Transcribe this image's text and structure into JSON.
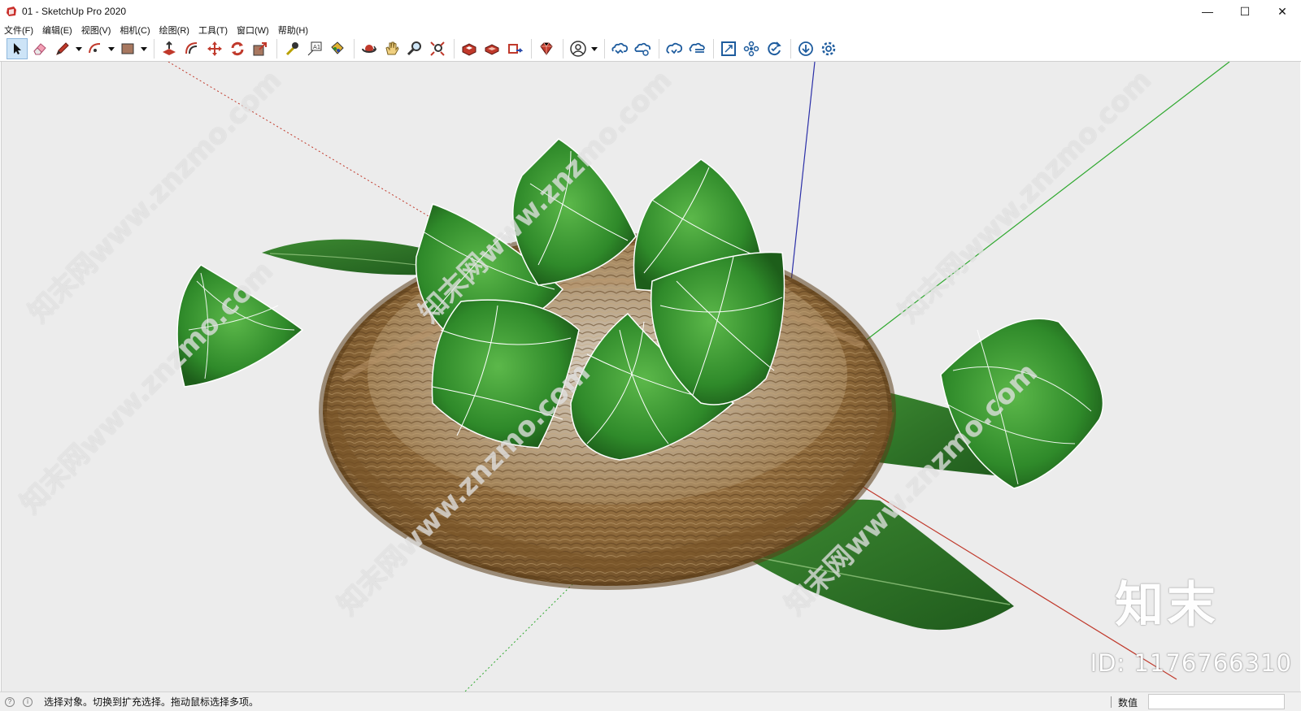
{
  "window": {
    "title": "01 - SketchUp Pro 2020",
    "controls": {
      "minimize": "—",
      "maximize": "☐",
      "close": "✕"
    }
  },
  "menu": [
    "文件(F)",
    "编辑(E)",
    "视图(V)",
    "相机(C)",
    "绘图(R)",
    "工具(T)",
    "窗口(W)",
    "帮助(H)"
  ],
  "toolbar": {
    "tools": [
      "select-icon",
      "eraser-icon",
      "pencil-icon",
      "arc-icon",
      "rectangle-icon",
      "push-pull-icon",
      "offset-icon",
      "move-icon",
      "rotate-icon",
      "scale-icon",
      "tape-measure-icon",
      "text-icon",
      "paint-bucket-icon",
      "orbit-icon",
      "pan-icon",
      "zoom-icon",
      "zoom-extents-icon",
      "warehouse-icon",
      "extension-warehouse-icon",
      "send-to-layout-icon",
      "ruby-icon",
      "account-icon",
      "cloud-icon",
      "cloud-share-icon",
      "cloud-upload-icon",
      "cloud-sync-icon",
      "frame-icon",
      "cluster-icon",
      "refresh-check-icon",
      "download-icon",
      "settings-icon"
    ],
    "active_tool": "select-icon"
  },
  "viewport": {
    "scene": "woven basket with green leaf-wrapped zongzi on bamboo leaves",
    "axis_colors": {
      "red": "#c0392b",
      "green": "#2ea82e",
      "blue": "#2b2fa8"
    }
  },
  "watermark": {
    "logo": "知末",
    "id": "ID: 1176766310",
    "repeat": "知末网www.znzmo.com"
  },
  "status": {
    "message": "选择对象。切换到扩充选择。拖动鼠标选择多项。",
    "measurement_label": "数值",
    "measurement_value": ""
  }
}
